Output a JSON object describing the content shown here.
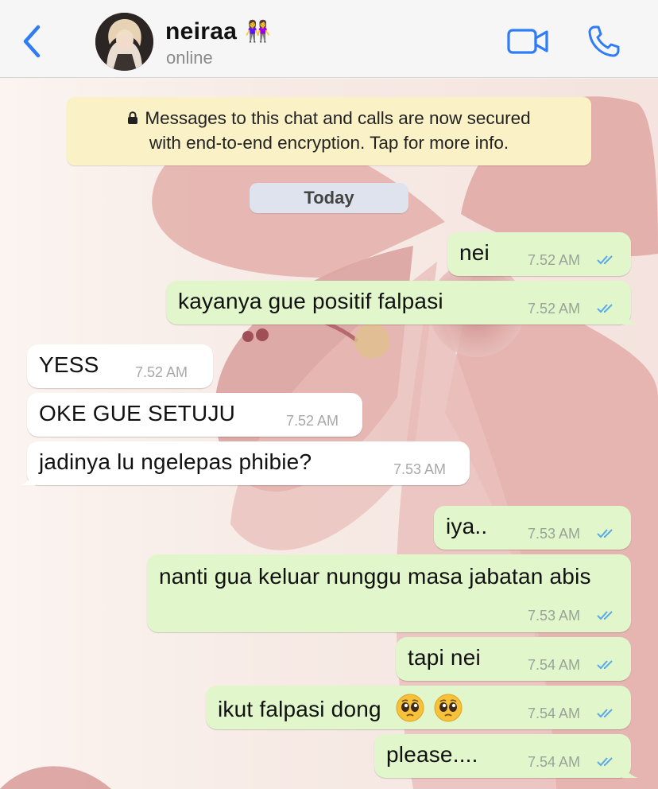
{
  "header": {
    "contact_name": "neiraa",
    "contact_emoji": "👭",
    "status": "online"
  },
  "chat": {
    "encryption_notice_line1": "Messages to this chat and calls are now secured",
    "encryption_notice_line2": "with end-to-end encryption. Tap for more info.",
    "date_separator": "Today",
    "messages": [
      {
        "direction": "out",
        "text": "nei",
        "time": "7.52 AM"
      },
      {
        "direction": "out",
        "text": "kayanya gue positif falpasi",
        "time": "7.52 AM"
      },
      {
        "direction": "in",
        "text": "YESS",
        "time": "7.52 AM"
      },
      {
        "direction": "in",
        "text": "OKE GUE SETUJU",
        "time": "7.52 AM"
      },
      {
        "direction": "in",
        "text": "jadinya lu ngelepas phibie?",
        "time": "7.53 AM"
      },
      {
        "direction": "out",
        "text": "iya..",
        "time": "7.53 AM"
      },
      {
        "direction": "out",
        "text": "nanti gua keluar nunggu masa jabatan abis",
        "time": "7.53 AM"
      },
      {
        "direction": "out",
        "text": "tapi nei",
        "time": "7.54 AM"
      },
      {
        "direction": "out",
        "text": "ikut falpasi dong",
        "emojis": "🥺🥺",
        "time": "7.54 AM"
      },
      {
        "direction": "out",
        "text": "please....",
        "time": "7.54 AM"
      }
    ]
  },
  "icons": [
    "back-chevron-icon",
    "video-call-icon",
    "phone-call-icon",
    "lock-icon",
    "double-check-icon",
    "pleading-face-emoji"
  ],
  "colors": {
    "accent": "#2f7cf6",
    "outgoing_bubble": "#e1f7cb",
    "incoming_bubble": "#ffffff",
    "encryption_notice_bg": "#faf2c6",
    "read_tick": "#5aa9e8"
  }
}
